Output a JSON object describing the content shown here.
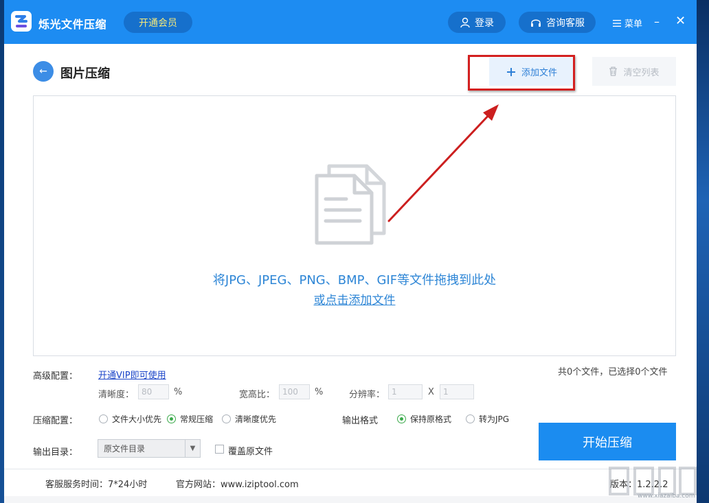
{
  "app": {
    "title": "烁光文件压缩",
    "vip_label": "开通会员",
    "login_label": "登录",
    "service_label": "咨询客服",
    "menu_label": "菜单",
    "minimize": "–",
    "close": "✕"
  },
  "page": {
    "title": "图片压缩",
    "back_glyph": "←",
    "add_file_label": "添加文件",
    "clear_list_label": "清空列表"
  },
  "dropzone": {
    "hint": "将JPG、JPEG、PNG、BMP、GIF等文件拖拽到此处",
    "link": "或点击添加文件"
  },
  "advanced": {
    "label": "高级配置：",
    "vip_link": "开通VIP即可使用",
    "clarity_label": "清晰度：",
    "clarity_value": "80",
    "clarity_unit": "%",
    "ratio_label": "宽高比：",
    "ratio_value": "100",
    "ratio_unit": "%",
    "resolution_label": "分辨率：",
    "res_w": "1",
    "res_sep": "X",
    "res_h": "1"
  },
  "status": {
    "file_count": "共0个文件，已选择0个文件"
  },
  "compress": {
    "label": "压缩配置：",
    "options": [
      "文件大小优先",
      "常规压缩",
      "清晰度优先"
    ],
    "selected_index": 1
  },
  "output_format": {
    "label": "输出格式",
    "options": [
      "保持原格式",
      "转为JPG"
    ],
    "selected_index": 0
  },
  "output_dir": {
    "label": "输出目录：",
    "selected": "原文件目录",
    "overwrite_label": "覆盖原文件",
    "overwrite_checked": false
  },
  "start_button": "开始压缩",
  "footer": {
    "service_time": "客服服务时间：7*24小时",
    "website": "官方网站：www.iziptool.com",
    "version": "版本：1.2.2.2"
  },
  "watermark": "www.xiazaiba.com",
  "colors": {
    "primary": "#1d8cf2",
    "highlight_box": "#d31f1f",
    "arrow": "#cc1f1f",
    "link_blue": "#2e86d6",
    "radio_on": "#3aaa4a"
  },
  "icons": [
    "app-logo-icon",
    "user-icon",
    "headset-icon",
    "menu-icon",
    "back-arrow-icon",
    "plus-icon",
    "trash-icon",
    "document-icon",
    "dropdown-caret-icon"
  ]
}
